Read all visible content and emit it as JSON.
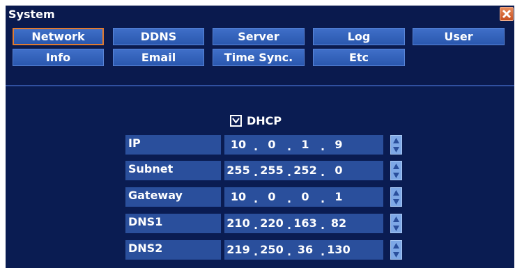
{
  "window": {
    "title": "System"
  },
  "tabs": [
    {
      "label": "Network",
      "active": true
    },
    {
      "label": "DDNS"
    },
    {
      "label": "Server"
    },
    {
      "label": "Log"
    },
    {
      "label": "User"
    },
    {
      "label": "Info"
    },
    {
      "label": "Email"
    },
    {
      "label": "Time Sync."
    },
    {
      "label": "Etc"
    }
  ],
  "dhcp": {
    "label": "DHCP",
    "checked": true
  },
  "fields": [
    {
      "label": "IP",
      "octets": [
        "10",
        "0",
        "1",
        "9"
      ]
    },
    {
      "label": "Subnet",
      "octets": [
        "255",
        "255",
        "252",
        "0"
      ]
    },
    {
      "label": "Gateway",
      "octets": [
        "10",
        "0",
        "0",
        "1"
      ]
    },
    {
      "label": "DNS1",
      "octets": [
        "210",
        "220",
        "163",
        "82"
      ]
    },
    {
      "label": "DNS2",
      "octets": [
        "219",
        "250",
        "36",
        "130"
      ]
    }
  ],
  "colors": {
    "accent": "#e07a30",
    "panel": "#0a1c52",
    "control": "#2a4f9c"
  }
}
